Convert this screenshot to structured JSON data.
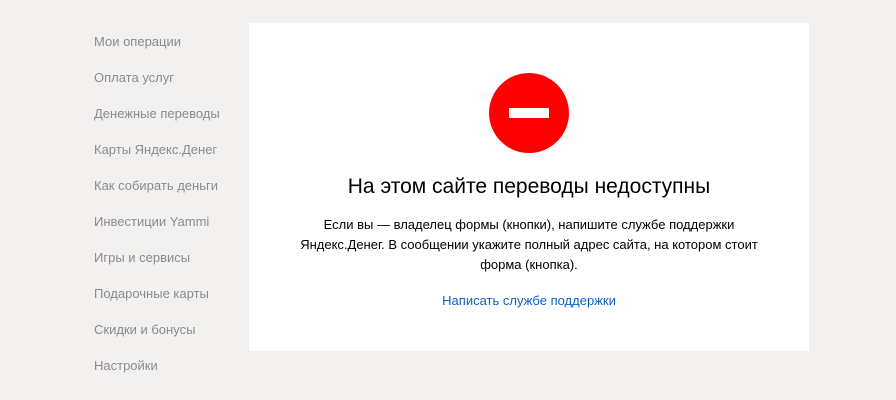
{
  "sidebar": {
    "items": [
      {
        "label": "Мои операции"
      },
      {
        "label": "Оплата услуг"
      },
      {
        "label": "Денежные переводы"
      },
      {
        "label": "Карты Яндекс.Денег"
      },
      {
        "label": "Как собирать деньги"
      },
      {
        "label": "Инвестиции Yammi"
      },
      {
        "label": "Игры и сервисы"
      },
      {
        "label": "Подарочные карты"
      },
      {
        "label": "Скидки и бонусы"
      },
      {
        "label": "Настройки"
      }
    ]
  },
  "error_card": {
    "icon": "stop-icon",
    "icon_color": "#ff0000",
    "title": "На этом сайте переводы недоступны",
    "message_lines": [
      "Если вы — владелец формы (кнопки), напишите службе поддержки",
      "Яндекс.Денег. В сообщении укажите полный адрес сайта, на котором стоит",
      "форма (кнопка)."
    ],
    "support_link_label": "Написать службе поддержки",
    "link_color": "#0a63c9"
  }
}
